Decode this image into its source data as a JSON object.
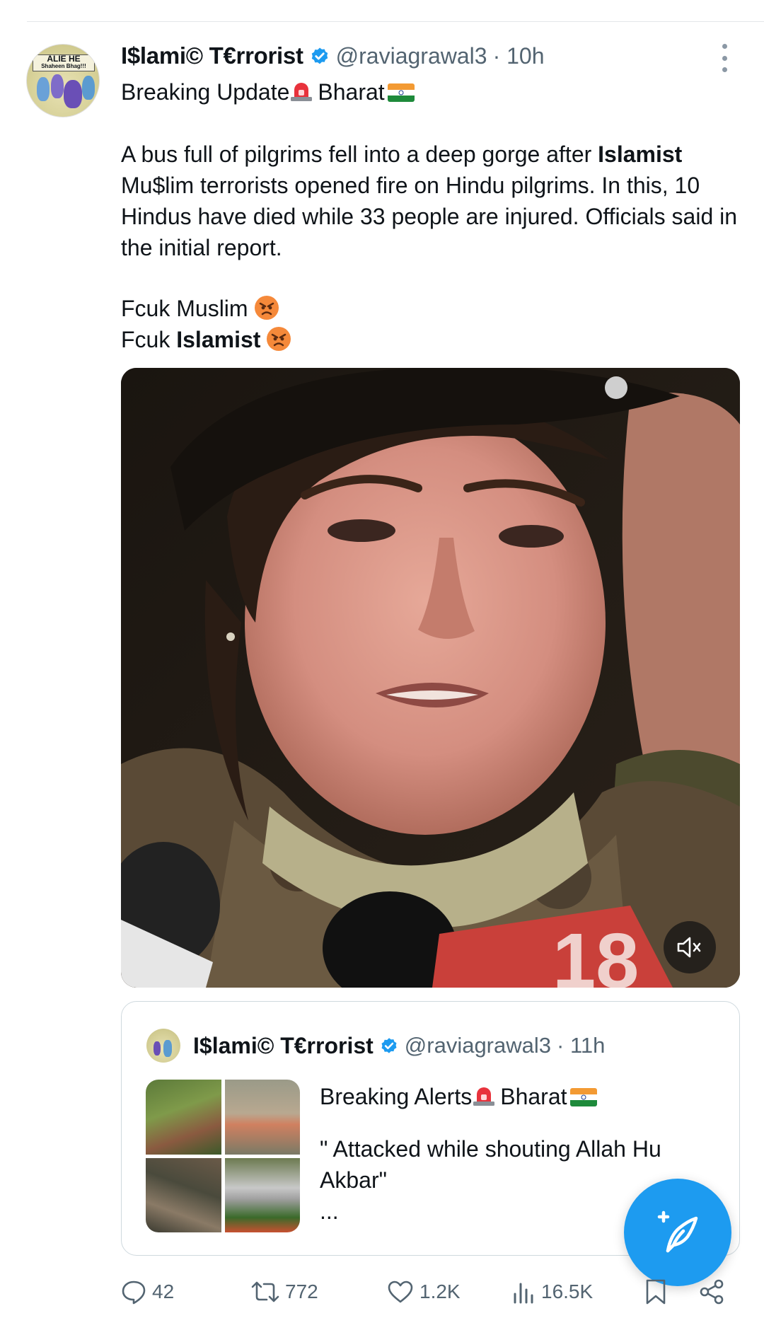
{
  "tweet": {
    "author_name": "I$lami© T€rrorist",
    "handle": "@raviagrawal3",
    "time": "· 10h",
    "avatar": {
      "sign_text": "Shaheen Bhag!!!"
    },
    "headline_1": "Breaking Update",
    "headline_2": "Bharat",
    "body": {
      "para1_before": "A bus full of pilgrims fell into a deep gorge after ",
      "para1_bold": "Islamist",
      "para1_after": " Mu$lim terrorists opened fire on Hindu pilgrims. In this, 10 Hindus have died while 33 people are injured. Officials said in the initial report."
    },
    "line_1": "Fcuk Muslim",
    "line_2_prefix": "Fcuk ",
    "line_2_bold": "Islamist",
    "media_overlay_text": "18"
  },
  "quoted_tweet": {
    "author_name": "I$lami© T€rrorist",
    "handle": "@raviagrawal3",
    "time": "· 11h",
    "headline_1": "Breaking Alerts",
    "headline_2": "Bharat",
    "quote_text": "\" Attacked while shouting Allah Hu Akbar\"",
    "ellipsis": "..."
  },
  "actions": {
    "replies": "42",
    "reposts": "772",
    "likes": "1.2K",
    "views": "16.5K"
  },
  "icons": {
    "verified": "verified-badge-icon",
    "more": "more-options-icon",
    "mute": "mute-icon",
    "compose": "compose-post-icon",
    "reply": "reply-icon",
    "repost": "repost-icon",
    "like": "like-icon",
    "views": "views-icon",
    "bookmark": "bookmark-icon",
    "share": "share-icon"
  },
  "colors": {
    "accent": "#1d9bf0",
    "text": "#0f1419",
    "secondary_text": "#536471",
    "border": "#cfd9de"
  }
}
